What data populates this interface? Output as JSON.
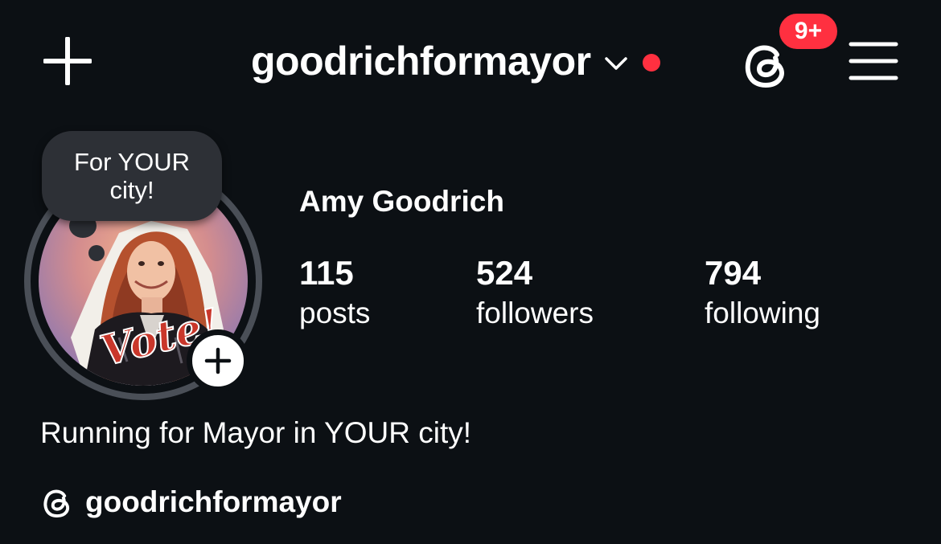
{
  "colors": {
    "background": "#0c1014",
    "text": "#ffffff",
    "notification_red": "#ff3040",
    "story_ring": "#4a4f57",
    "note_bubble": "#2d3036"
  },
  "header": {
    "new_post_icon": "plus-icon",
    "username": "goodrichformayor",
    "account_switch_icon": "chevron-down-icon",
    "threads_icon": "threads-icon",
    "threads_badge": "9+",
    "menu_icon": "hamburger-menu-icon"
  },
  "profile": {
    "note": "For YOUR city!",
    "avatar_sticker_text": "Vote!",
    "add_story_icon": "plus-icon",
    "display_name": "Amy Goodrich",
    "stats": [
      {
        "count": "115",
        "label": "posts"
      },
      {
        "count": "524",
        "label": "followers"
      },
      {
        "count": "794",
        "label": "following"
      }
    ],
    "bio": "Running for Mayor in YOUR city!",
    "threads_handle": "goodrichformayor"
  }
}
